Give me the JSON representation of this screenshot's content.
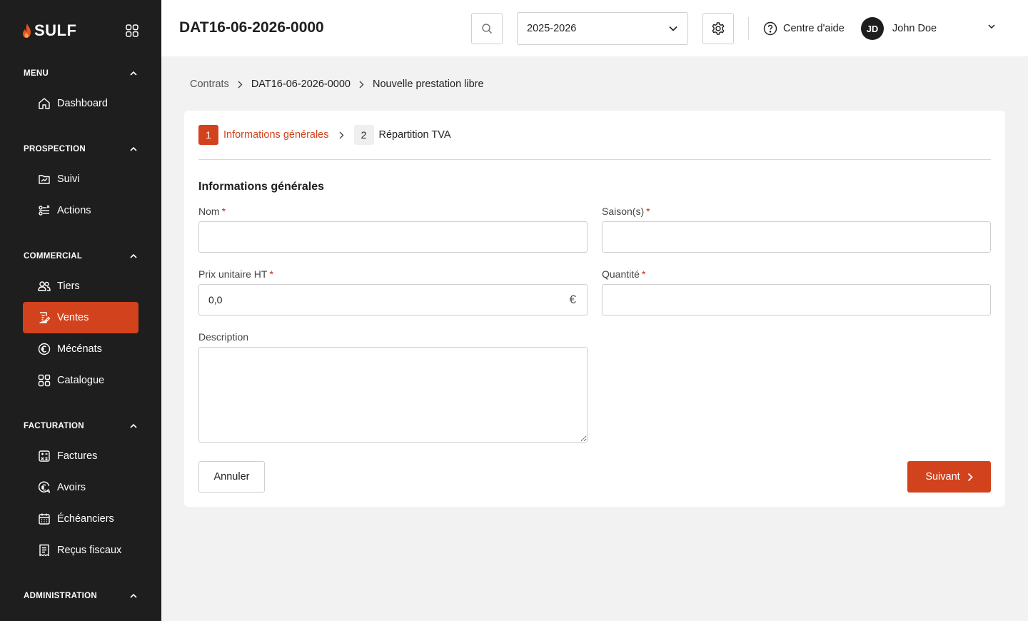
{
  "app": {
    "logo_text": "SULF"
  },
  "sidebar": {
    "sections": [
      {
        "title": "MENU",
        "items": [
          {
            "label": "Dashboard",
            "icon": "home-icon"
          }
        ]
      },
      {
        "title": "PROSPECTION",
        "items": [
          {
            "label": "Suivi",
            "icon": "folder-chart-icon"
          },
          {
            "label": "Actions",
            "icon": "actions-icon"
          }
        ]
      },
      {
        "title": "COMMERCIAL",
        "items": [
          {
            "label": "Tiers",
            "icon": "users-icon"
          },
          {
            "label": "Ventes",
            "icon": "document-edit-icon",
            "active": true
          },
          {
            "label": "Mécénats",
            "icon": "euro-circle-icon"
          },
          {
            "label": "Catalogue",
            "icon": "grid-icon"
          }
        ]
      },
      {
        "title": "FACTURATION",
        "items": [
          {
            "label": "Factures",
            "icon": "calculator-icon"
          },
          {
            "label": "Avoirs",
            "icon": "euro-refund-icon"
          },
          {
            "label": "Échéanciers",
            "icon": "calendar-icon"
          },
          {
            "label": "Reçus fiscaux",
            "icon": "receipt-icon"
          }
        ]
      },
      {
        "title": "ADMINISTRATION",
        "items": []
      }
    ]
  },
  "header": {
    "contract_title": "DAT16-06-2026-0000",
    "season_value": "2025-2026",
    "help_label": "Centre d'aide",
    "user_initials": "JD",
    "user_name": "John Doe"
  },
  "breadcrumb": [
    "Contrats",
    "DAT16-06-2026-0000",
    "Nouvelle prestation libre"
  ],
  "stepper": [
    {
      "num": "1",
      "label": "Informations générales",
      "active": true
    },
    {
      "num": "2",
      "label": "Répartition TVA",
      "active": false
    }
  ],
  "form": {
    "title": "Informations générales",
    "nom_label": "Nom",
    "nom_value": "",
    "saisons_label": "Saison(s)",
    "saisons_value": "",
    "prix_label": "Prix unitaire HT",
    "prix_value": "0,0",
    "prix_suffix": "€",
    "quantite_label": "Quantité",
    "quantite_value": "",
    "description_label": "Description",
    "description_value": "",
    "required_mark": "*"
  },
  "actions": {
    "cancel_label": "Annuler",
    "next_label": "Suivant"
  },
  "colors": {
    "accent": "#d2421c",
    "sidebar_bg": "#1e1e1e",
    "required": "#c8291d"
  }
}
